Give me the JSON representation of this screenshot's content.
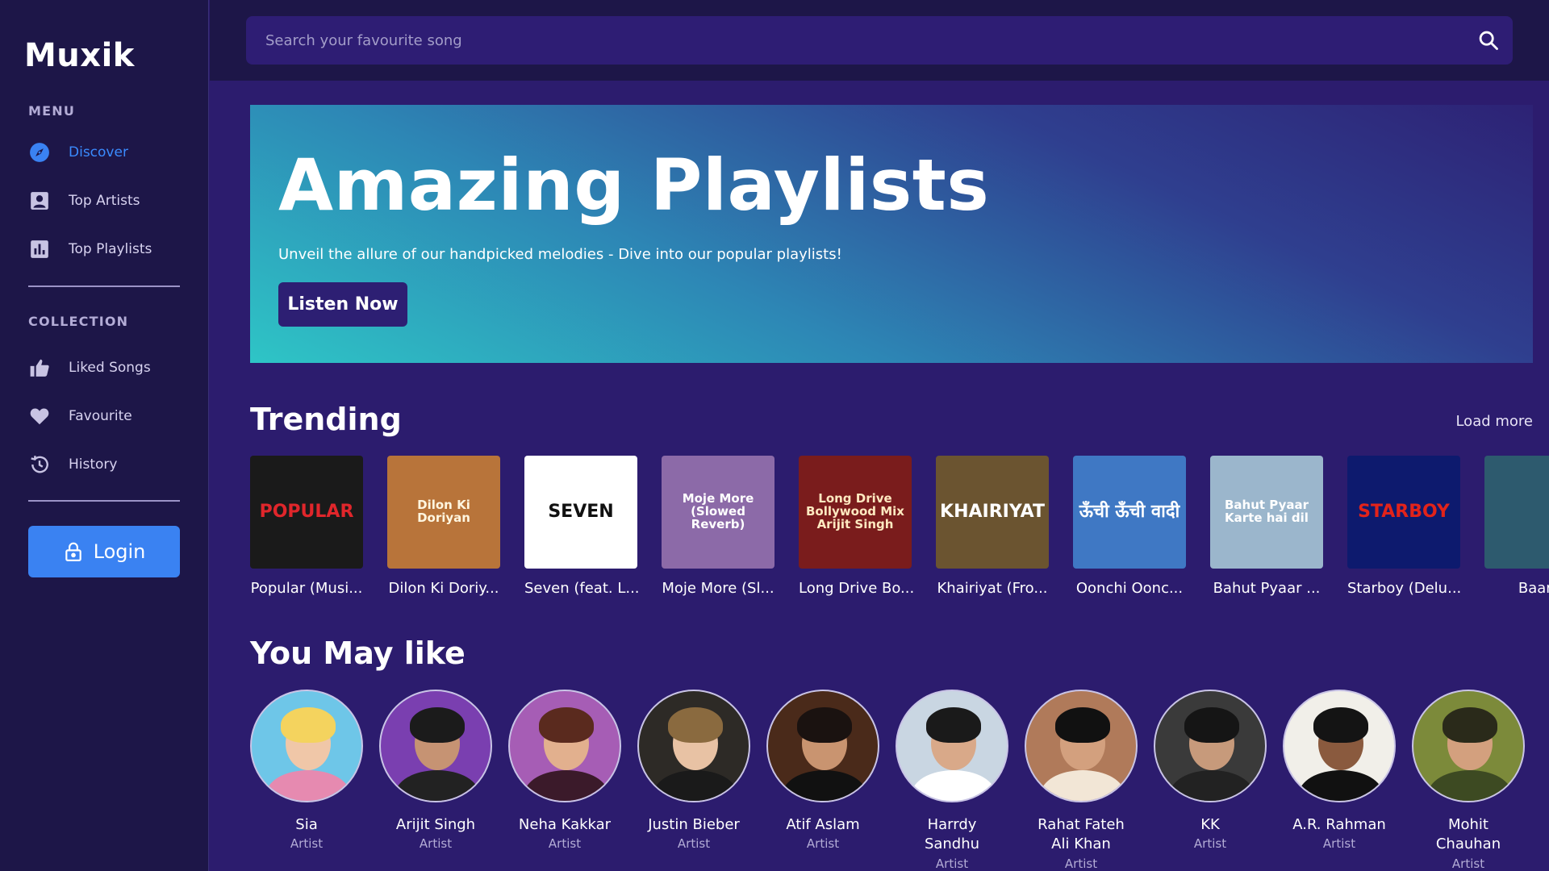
{
  "app": {
    "logo": "Muxik"
  },
  "sidebar": {
    "menu_label": "MENU",
    "menu_items": [
      {
        "label": "Discover",
        "icon": "compass-icon",
        "active": true
      },
      {
        "label": "Top Artists",
        "icon": "artist-icon",
        "active": false
      },
      {
        "label": "Top Playlists",
        "icon": "chart-icon",
        "active": false
      }
    ],
    "collection_label": "COLLECTION",
    "collection_items": [
      {
        "label": "Liked Songs",
        "icon": "thumbs-up-icon"
      },
      {
        "label": "Favourite",
        "icon": "heart-icon"
      },
      {
        "label": "History",
        "icon": "history-icon"
      }
    ],
    "login_label": "Login"
  },
  "search": {
    "placeholder": "Search your favourite song"
  },
  "hero": {
    "title": "Amazing Playlists",
    "subtitle": "Unveil the allure of our handpicked melodies - Dive into our popular playlists!",
    "button": "Listen Now"
  },
  "trending": {
    "title": "Trending",
    "load_more": "Load more",
    "tracks": [
      {
        "title": "Popular (Musi...",
        "cover_text": "POPULAR",
        "bg": "#1a1a1a",
        "fg": "#e0262b"
      },
      {
        "title": "Dilon Ki Doriy...",
        "cover_text": "Dilon Ki Doriyan",
        "bg": "#b8743a",
        "fg": "#fff6e0"
      },
      {
        "title": "Seven (feat. L...",
        "cover_text": "SEVEN",
        "bg": "#ffffff",
        "fg": "#111111"
      },
      {
        "title": "Moje More (Sl...",
        "cover_text": "Moje More (Slowed Reverb)",
        "bg": "#8c6aa8",
        "fg": "#ffffff"
      },
      {
        "title": "Long Drive Bo...",
        "cover_text": "Long Drive Bollywood Mix Arijit Singh",
        "bg": "#7a1c1c",
        "fg": "#ffe9c0"
      },
      {
        "title": "Khairiyat (Fro...",
        "cover_text": "KHAIRIYAT",
        "bg": "#6b5430",
        "fg": "#ffffff"
      },
      {
        "title": "Oonchi Oonc...",
        "cover_text": "ऊँची ऊँची वादी",
        "bg": "#3f78c4",
        "fg": "#ffffff"
      },
      {
        "title": "Bahut Pyaar ...",
        "cover_text": "Bahut Pyaar Karte hai dil",
        "bg": "#9bb6cc",
        "fg": "#ffffff"
      },
      {
        "title": "Starboy (Delu...",
        "cover_text": "STARBOY",
        "bg": "#0d1a6e",
        "fg": "#e2231a"
      },
      {
        "title": "Baaris",
        "cover_text": "",
        "bg": "#2d5a6e",
        "fg": "#ffffff"
      }
    ]
  },
  "you_may_like": {
    "title": "You May like",
    "artists": [
      {
        "name": "Sia",
        "role": "Artist",
        "bg": "#6ec6e8",
        "hair": "#f4d35e",
        "skin": "#f0c7a8",
        "shirt": "#e68ab0"
      },
      {
        "name": "Arijit Singh",
        "role": "Artist",
        "bg": "#7a3fb0",
        "hair": "#1b1b1b",
        "skin": "#c69373",
        "shirt": "#222222"
      },
      {
        "name": "Neha Kakkar",
        "role": "Artist",
        "bg": "#a65db5",
        "hair": "#5a2a1e",
        "skin": "#e2b08e",
        "shirt": "#3b1a2a"
      },
      {
        "name": "Justin Bieber",
        "role": "Artist",
        "bg": "#2d2a26",
        "hair": "#8a6a3f",
        "skin": "#e8c2a4",
        "shirt": "#1a1a1a"
      },
      {
        "name": "Atif Aslam",
        "role": "Artist",
        "bg": "#4a2a1a",
        "hair": "#1a1210",
        "skin": "#c99470",
        "shirt": "#111111"
      },
      {
        "name": "Harrdy Sandhu",
        "role": "Artist",
        "bg": "#c9d6e2",
        "hair": "#1a1a1a",
        "skin": "#d9a989",
        "shirt": "#ffffff"
      },
      {
        "name": "Rahat Fateh Ali Khan",
        "role": "Artist",
        "bg": "#b07a5a",
        "hair": "#111111",
        "skin": "#d3a07e",
        "shirt": "#f2e6d6"
      },
      {
        "name": "KK",
        "role": "Artist",
        "bg": "#3a3a3a",
        "hair": "#151515",
        "skin": "#c79a7b",
        "shirt": "#222222"
      },
      {
        "name": "A.R. Rahman",
        "role": "Artist",
        "bg": "#f1efe9",
        "hair": "#141414",
        "skin": "#8a5a3e",
        "shirt": "#111111"
      },
      {
        "name": "Mohit Chauhan",
        "role": "Artist",
        "bg": "#7c8a3a",
        "hair": "#2a2a1a",
        "skin": "#d3a07e",
        "shirt": "#3d4a22"
      }
    ]
  },
  "colors": {
    "accent": "#3a82f2",
    "active_nav": "#3a8bff",
    "background": "#2c1c6e",
    "sidebar": "#1d1648"
  }
}
